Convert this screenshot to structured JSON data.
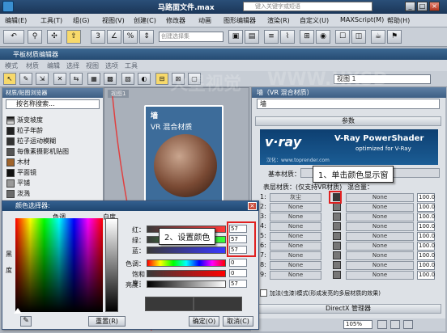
{
  "app": {
    "title": "马路面文件.max",
    "search_placeholder": "键入关键字或短语",
    "menus": [
      "编辑(E)",
      "工具(T)",
      "组(G)",
      "视图(V)",
      "创建(C)",
      "修改器",
      "动画",
      "图形编辑器",
      "渲染(R)",
      "自定义(U)",
      "MAXScript(M)",
      "帮助(H)"
    ],
    "toolbar": {
      "all_label": "全部",
      "selection_set_placeholder": "创建选择集"
    }
  },
  "material_editor": {
    "title": "平板材质编辑器",
    "menus": [
      "模式",
      "材质",
      "编辑",
      "选择",
      "视图",
      "选项",
      "工具"
    ],
    "view_dropdown": "视图 1"
  },
  "browser": {
    "title": "材质/贴图浏览器",
    "search_placeholder": "按名称搜索...",
    "items": [
      "渐变坡度",
      "粒子年龄",
      "粒子运动模糊",
      "每像素摄影机贴图",
      "木材",
      "平面镜",
      "平铺",
      "泼溅"
    ]
  },
  "view_panel": {
    "tab": "视图1"
  },
  "node": {
    "title": "墙",
    "type": "VR 混合材质"
  },
  "props": {
    "header": "墙（VR 混合材质）",
    "name": "墙",
    "rollout": "参数",
    "banner_title": "V-Ray PowerShader",
    "banner_sub": "optimized for V-Ray",
    "banner_credit": "汉化：www.toprender.com",
    "base_label": "基本材质：",
    "coat_label": "表层材质：(仅支持VR材质)",
    "blend_label": "混合量：",
    "rows": [
      {
        "num": "1:",
        "coat": "灰尘",
        "blend": "None",
        "val": "100.0"
      },
      {
        "num": "2:",
        "coat": "None",
        "blend": "None",
        "val": "100.0"
      },
      {
        "num": "3:",
        "coat": "None",
        "blend": "None",
        "val": "100.0"
      },
      {
        "num": "4:",
        "coat": "None",
        "blend": "None",
        "val": "100.0"
      },
      {
        "num": "5:",
        "coat": "None",
        "blend": "None",
        "val": "100.0"
      },
      {
        "num": "6:",
        "coat": "None",
        "blend": "None",
        "val": "100.0"
      },
      {
        "num": "7:",
        "coat": "None",
        "blend": "None",
        "val": "100.0"
      },
      {
        "num": "8:",
        "coat": "None",
        "blend": "None",
        "val": "100.0"
      },
      {
        "num": "9:",
        "coat": "None",
        "blend": "None",
        "val": "100.0"
      }
    ],
    "additive_label": "加法(虫漆)模式(形成发亮的多层材质的效果)",
    "directx": "DirectX 管理器",
    "zoom": "105%"
  },
  "color_dialog": {
    "title": "颜色选择器:",
    "hue_label": "色调",
    "white_label": "白度",
    "black_label": "黑",
    "degree_label": "度",
    "red_label": "红：",
    "green_label": "绿：",
    "blue_label": "蓝：",
    "hue2_label": "色调：",
    "sat_label": "饱和度：",
    "val_label": "亮度：",
    "red": "57",
    "green": "57",
    "blue": "57",
    "hue_val": "0",
    "sat_val": "0",
    "bright_val": "57",
    "reset_label": "重置(R)",
    "ok_label": "确定(O)",
    "cancel_label": "取消(C)"
  },
  "callouts": {
    "one": "1、单击颜色显示窗",
    "two": "2、设置颜色"
  },
  "watermarks": [
    "火星视觉",
    "WWW.HXSD"
  ],
  "colors": {
    "accent_red": "#e02020",
    "title_blue": "#254b72",
    "gray_swatch": "#393939"
  }
}
